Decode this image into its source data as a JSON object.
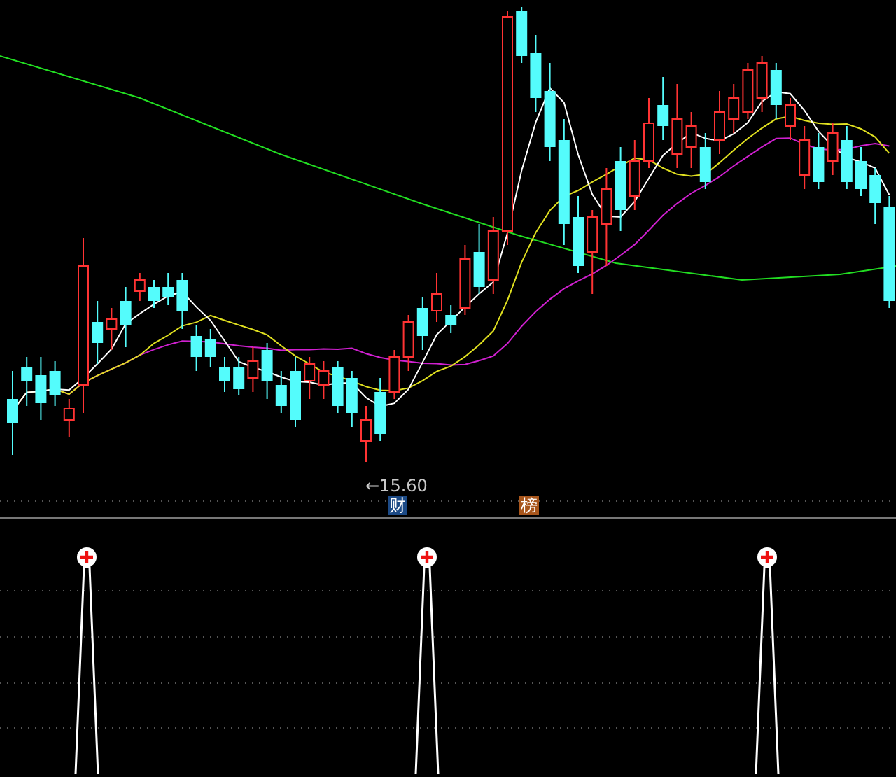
{
  "price_panel": {
    "low_label": "←15.60",
    "badges": [
      {
        "text": "财",
        "color": "#1c4a86"
      },
      {
        "text": "榜",
        "color": "#a8561c"
      }
    ]
  }
}
